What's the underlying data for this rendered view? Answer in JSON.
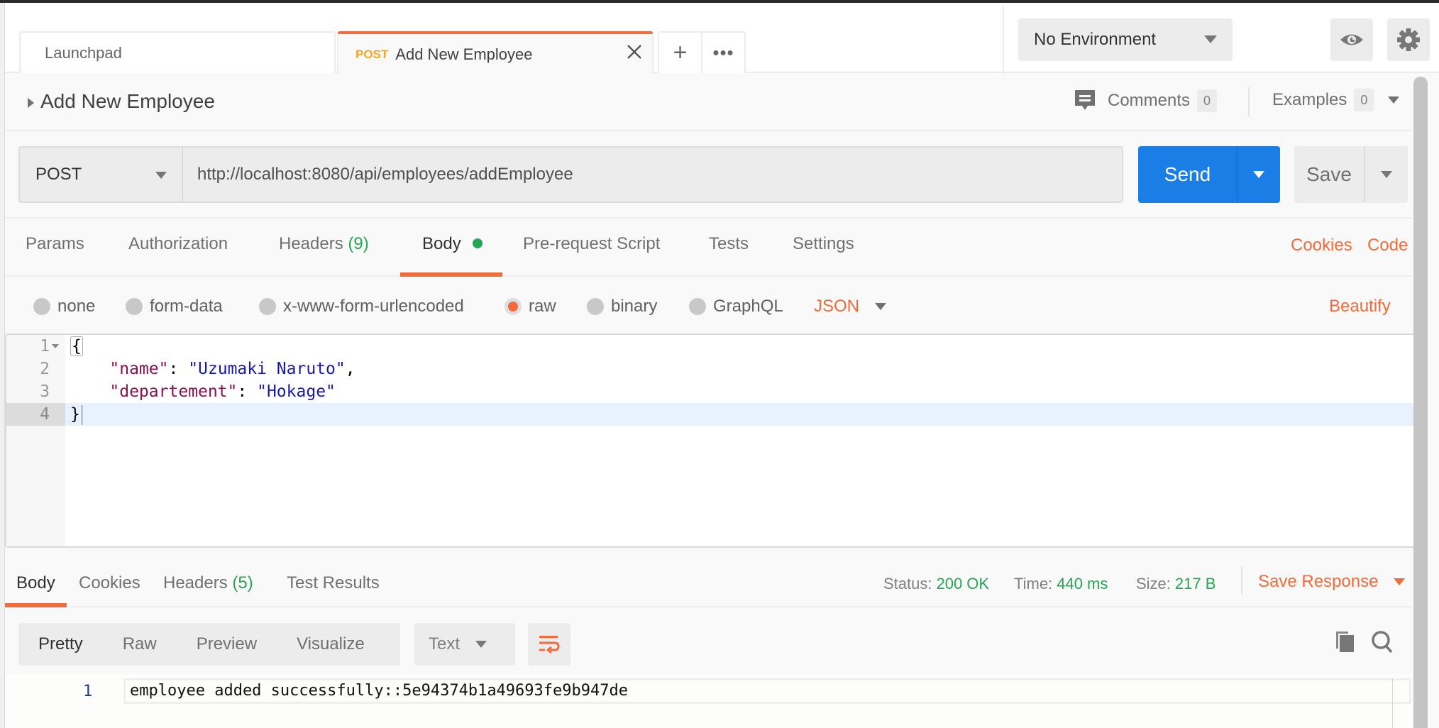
{
  "tabs": [
    {
      "label": "Launchpad"
    },
    {
      "method": "POST",
      "label": "Add New Employee",
      "active": true
    }
  ],
  "tab_actions": {
    "add": "+",
    "more": "•••"
  },
  "environment": {
    "selected": "No Environment"
  },
  "request": {
    "title": "Add New Employee",
    "comments_label": "Comments",
    "comments_count": "0",
    "examples_label": "Examples",
    "examples_count": "0",
    "method": "POST",
    "url": "http://localhost:8080/api/employees/addEmployee",
    "send_label": "Send",
    "save_label": "Save"
  },
  "request_tabs": {
    "params": "Params",
    "authorization": "Authorization",
    "headers": "Headers",
    "headers_count": "(9)",
    "body": "Body",
    "pre_request": "Pre-request Script",
    "tests": "Tests",
    "settings": "Settings",
    "cookies": "Cookies",
    "code": "Code"
  },
  "body_types": {
    "none": "none",
    "form_data": "form-data",
    "urlencoded": "x-www-form-urlencoded",
    "raw": "raw",
    "binary": "binary",
    "graphql": "GraphQL",
    "format": "JSON",
    "beautify": "Beautify",
    "selected": "raw"
  },
  "editor": {
    "line_numbers": [
      "1",
      "2",
      "3",
      "4"
    ],
    "lines": {
      "l1": "{",
      "l2_key": "\"name\"",
      "l2_value": "\"Uzumaki Naruto\"",
      "l3_key": "\"departement\"",
      "l3_value": "\"Hokage\"",
      "l4": "}"
    }
  },
  "response_tabs": {
    "body": "Body",
    "cookies": "Cookies",
    "headers": "Headers",
    "headers_count": "(5)",
    "test_results": "Test Results"
  },
  "response_meta": {
    "status_label": "Status:",
    "status_value": "200 OK",
    "time_label": "Time:",
    "time_value": "440 ms",
    "size_label": "Size:",
    "size_value": "217 B",
    "save_response": "Save Response"
  },
  "response_view": {
    "pretty": "Pretty",
    "raw": "Raw",
    "preview": "Preview",
    "visualize": "Visualize",
    "format": "Text"
  },
  "response_body": {
    "line_number": "1",
    "text": "employee added successfully::5e94374b1a49693fe9b947de"
  },
  "colors": {
    "accent": "#f26b3a",
    "send_blue": "#1b7ee6",
    "success_green": "#26a556",
    "method_post": "#f5a623"
  }
}
